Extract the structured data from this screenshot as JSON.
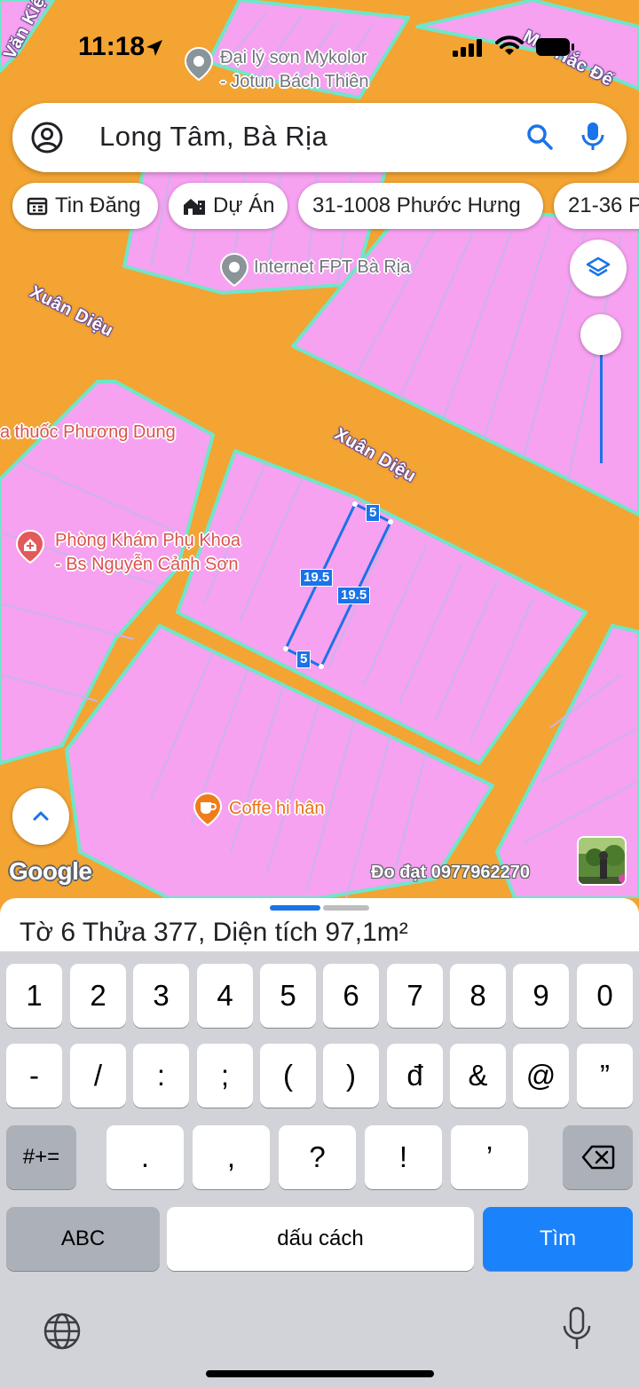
{
  "status_bar": {
    "time": "11:18",
    "icons": [
      "location-arrow-icon",
      "signal-icon",
      "wifi-icon",
      "battery-icon"
    ]
  },
  "search": {
    "query": "Long Tâm, Bà Rịa",
    "account_icon": "account-circle-icon",
    "search_icon": "search-icon",
    "mic_icon": "mic-icon"
  },
  "chips": [
    {
      "label": "Tin Đăng",
      "icon": "calendar-list-icon"
    },
    {
      "label": "Dự Án",
      "icon": "building-icon"
    },
    {
      "label": "31-1008 Phước Hưng",
      "icon": ""
    },
    {
      "label": "21-36 P",
      "icon": ""
    }
  ],
  "map": {
    "roads": [
      "Văn Kiệt",
      "Mai Hắc Đế",
      "Xuân Diệu",
      "Xuân Diệu"
    ],
    "pois": [
      {
        "name_line1": "Đại lý sơn Mykolor",
        "name_line2": "- Jotun Bách Thiên",
        "icon": "place-pin-icon"
      },
      {
        "name_line1": "Internet FPT Bà Rịa",
        "name_line2": "",
        "icon": "place-pin-icon"
      },
      {
        "name_line1": "a thuốc Phương Dung",
        "name_line2": "",
        "icon": ""
      },
      {
        "name_line1": "Phòng Khám Phụ Khoa",
        "name_line2": "- Bs Nguyễn Cảnh Sơn",
        "icon": "clinic-pin-icon"
      },
      {
        "name_line1": "Coffe hi hân",
        "name_line2": "",
        "icon": "cafe-pin-icon"
      }
    ],
    "parcel_dimensions": {
      "top": "5",
      "bottom": "5",
      "left_side": "19.5",
      "right_side": "19.5"
    },
    "google_logo": "Google",
    "credit": "Đo đạt 0977962270",
    "colors": {
      "road": "#f3a432",
      "parcel": "#f7a1f1",
      "parcel_border": "#6fe6c8",
      "selection": "#1a73e8"
    }
  },
  "sheet": {
    "prefix1": "Tờ ",
    "sheet_no": "6",
    "prefix2": " Thửa ",
    "parcel_no": "377",
    "prefix3": ", Diện tích ",
    "area": "97,1m²"
  },
  "keyboard": {
    "row1": [
      "1",
      "2",
      "3",
      "4",
      "5",
      "6",
      "7",
      "8",
      "9",
      "0"
    ],
    "row2": [
      "-",
      "/",
      ":",
      ";",
      "(",
      ")",
      "đ",
      "&",
      "@",
      "”"
    ],
    "row3_left": "#+=",
    "row3": [
      ".",
      ",",
      "?",
      "!",
      "’"
    ],
    "abc": "ABC",
    "space": "dấu cách",
    "search": "Tìm"
  }
}
